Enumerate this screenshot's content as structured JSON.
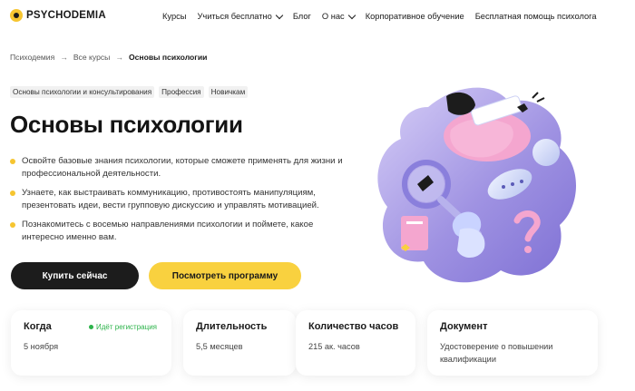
{
  "header": {
    "logo_text": "PSYCHODEMIA",
    "nav": [
      {
        "label": "Курсы"
      },
      {
        "label": "Учиться бесплатно"
      },
      {
        "label": "Блог"
      },
      {
        "label": "О нас"
      },
      {
        "label": "Корпоративное обучение"
      },
      {
        "label": "Бесплатная помощь психолога"
      }
    ]
  },
  "breadcrumb": {
    "home": "Психодемия",
    "sep": "→",
    "courses": "Все курсы",
    "current": "Основы психологии"
  },
  "tags": [
    "Основы психологии и консультирования",
    "Профессия",
    "Новичкам"
  ],
  "title": "Основы психологии",
  "bullets": [
    "Освойте базовые знания психологии, которые сможете применять для жизни и профессиональной деятельности.",
    "Узнаете, как выстраивать коммуникацию, противостоять манипуляциям, презентовать идеи, вести групповую дискуссию и управлять мотивацией.",
    "Познакомитесь с восемью направлениями психологии и поймете, какое интересно именно вам."
  ],
  "buttons": {
    "buy": "Купить сейчас",
    "program": "Посмотреть программу"
  },
  "cards": [
    {
      "title": "Когда",
      "value": "5 ноября",
      "badge": "Идёт регистрация"
    },
    {
      "title": "Длительность",
      "value": "5,5 месяцев"
    },
    {
      "title": "Количество часов",
      "value": "215 ак. часов"
    },
    {
      "title": "Документ",
      "value": "Удостоверение о повышении квалификации"
    }
  ],
  "colors": {
    "accent": "#f9d13f",
    "dark": "#1c1c1c",
    "success": "#2cb34a",
    "illustration_purple": "#9b8ee0",
    "illustration_pink": "#f4a6cf"
  }
}
